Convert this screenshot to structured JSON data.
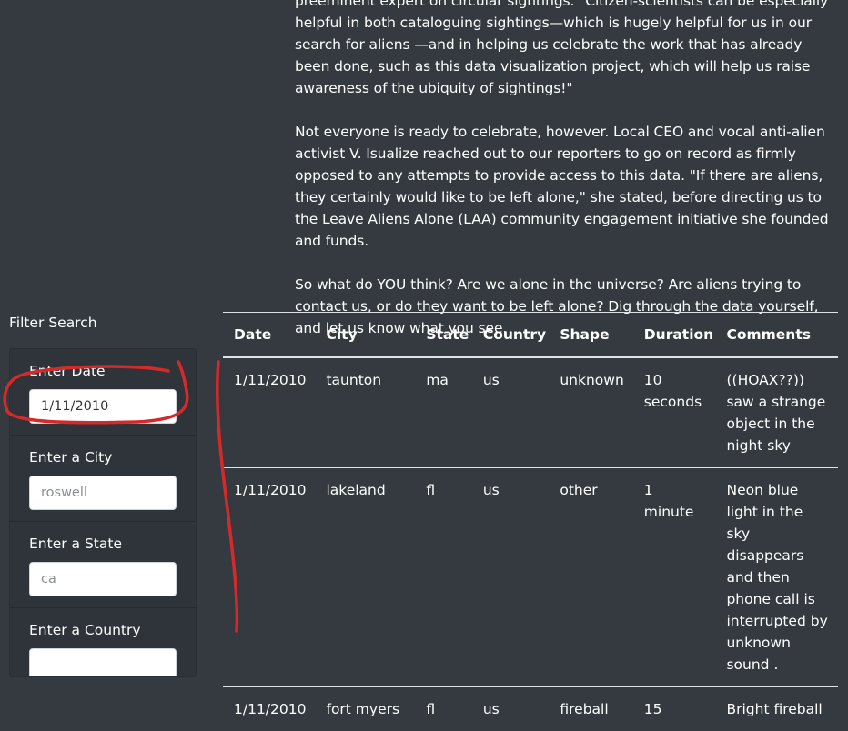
{
  "article": {
    "paragraphs": [
      "preeminent expert on circular sightings. \"Citizen-scientists can be especially helpful in both cataloguing sightings—which is hugely helpful for us in our search for aliens —and in helping us celebrate the work that has already been done, such as this data visualization project, which will help us raise awareness of the ubiquity of sightings!\"",
      "Not everyone is ready to celebrate, however. Local CEO and vocal anti-alien activist V. Isualize reached out to our reporters to go on record as firmly opposed to any attempts to provide access to this data. \"If there are aliens, they certainly would like to be left alone,\" she stated, before directing us to the Leave Aliens Alone (LAA) community engagement initiative she founded and funds.",
      "So what do YOU think? Are we alone in the universe? Are aliens trying to contact us, or do they want to be left alone? Dig through the data yourself, and let us know what you see."
    ]
  },
  "filters": {
    "title": "Filter Search",
    "items": [
      {
        "label": "Enter Date",
        "value": "1/11/2010",
        "placeholder": ""
      },
      {
        "label": "Enter a City",
        "value": "",
        "placeholder": "roswell"
      },
      {
        "label": "Enter a State",
        "value": "",
        "placeholder": "ca"
      },
      {
        "label": "Enter a Country",
        "value": "",
        "placeholder": ""
      }
    ]
  },
  "table": {
    "headers": [
      "Date",
      "City",
      "State",
      "Country",
      "Shape",
      "Duration",
      "Comments"
    ],
    "rows": [
      [
        "1/11/2010",
        "taunton",
        "ma",
        "us",
        "unknown",
        "10 seconds",
        "((HOAX??)) saw a strange object in the night sky"
      ],
      [
        "1/11/2010",
        "lakeland",
        "fl",
        "us",
        "other",
        "1 minute",
        "Neon blue light in the sky disappears and then phone call is interrupted by unknown sound ."
      ],
      [
        "1/11/2010",
        "fort myers",
        "fl",
        "us",
        "fireball",
        "15",
        "Bright fireball"
      ]
    ]
  },
  "colors": {
    "background": "#343a40",
    "text": "#ffffff",
    "annotation": "#d42a2a"
  }
}
